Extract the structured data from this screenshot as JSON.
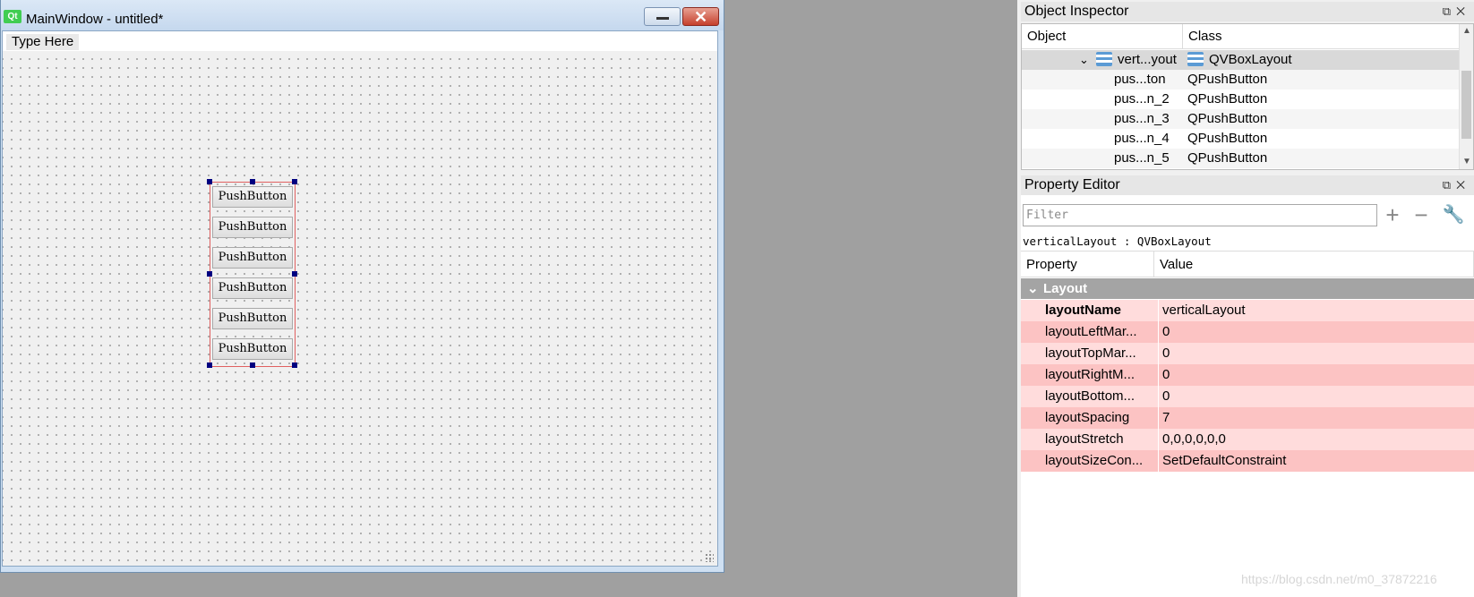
{
  "form_window": {
    "logo_text": "Qt",
    "title": "MainWindow - untitled*",
    "menu_placeholder": "Type Here",
    "buttons": [
      "PushButton",
      "PushButton",
      "PushButton",
      "PushButton",
      "PushButton",
      "PushButton"
    ]
  },
  "object_inspector": {
    "title": "Object Inspector",
    "columns": [
      "Object",
      "Class"
    ],
    "rows": [
      {
        "object": "vert...yout",
        "class": "QVBoxLayout"
      },
      {
        "object": "pus...ton",
        "class": "QPushButton"
      },
      {
        "object": "pus...n_2",
        "class": "QPushButton"
      },
      {
        "object": "pus...n_3",
        "class": "QPushButton"
      },
      {
        "object": "pus...n_4",
        "class": "QPushButton"
      },
      {
        "object": "pus...n_5",
        "class": "QPushButton"
      }
    ]
  },
  "property_editor": {
    "title": "Property Editor",
    "filter_placeholder": "Filter",
    "object_label": "verticalLayout : QVBoxLayout",
    "columns": [
      "Property",
      "Value"
    ],
    "group": "Layout",
    "properties": [
      {
        "name": "layoutName",
        "value": "verticalLayout"
      },
      {
        "name": "layoutLeftMar...",
        "value": "0"
      },
      {
        "name": "layoutTopMar...",
        "value": "0"
      },
      {
        "name": "layoutRightM...",
        "value": "0"
      },
      {
        "name": "layoutBottom...",
        "value": "0"
      },
      {
        "name": "layoutSpacing",
        "value": "7"
      },
      {
        "name": "layoutStretch",
        "value": "0,0,0,0,0,0"
      },
      {
        "name": "layoutSizeCon...",
        "value": "SetDefaultConstraint"
      }
    ]
  },
  "watermark": "https://blog.csdn.net/m0_37872216"
}
